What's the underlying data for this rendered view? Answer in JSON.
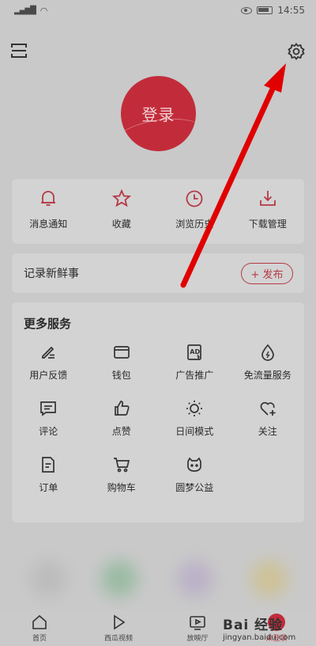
{
  "status_bar": {
    "carrier": "₀ᵢₗ",
    "time": "14:55"
  },
  "login": {
    "label": "登录"
  },
  "quick_actions": [
    {
      "label": "消息通知",
      "icon": "bell-icon"
    },
    {
      "label": "收藏",
      "icon": "star-icon"
    },
    {
      "label": "浏览历史",
      "icon": "clock-icon"
    },
    {
      "label": "下载管理",
      "icon": "download-icon"
    }
  ],
  "post_bar": {
    "label": "记录新鲜事",
    "button": "+ 发布"
  },
  "more_services": {
    "title": "更多服务",
    "items": [
      {
        "label": "用户反馈",
        "icon": "feedback-icon"
      },
      {
        "label": "钱包",
        "icon": "wallet-icon"
      },
      {
        "label": "广告推广",
        "icon": "ad-icon"
      },
      {
        "label": "免流量服务",
        "icon": "data-free-icon"
      },
      {
        "label": "评论",
        "icon": "comment-icon"
      },
      {
        "label": "点赞",
        "icon": "thumb-up-icon"
      },
      {
        "label": "日间模式",
        "icon": "sun-icon"
      },
      {
        "label": "关注",
        "icon": "heart-plus-icon"
      },
      {
        "label": "订单",
        "icon": "order-icon"
      },
      {
        "label": "购物车",
        "icon": "cart-icon"
      },
      {
        "label": "圆梦公益",
        "icon": "charity-icon"
      }
    ]
  },
  "tab_bar": [
    {
      "label": "首页",
      "icon": "home-icon"
    },
    {
      "label": "西瓜视频",
      "icon": "play-icon"
    },
    {
      "label": "放映厅",
      "icon": "tv-play-icon"
    },
    {
      "label": "未登录",
      "icon": "avatar-icon"
    }
  ],
  "watermark": {
    "brand": "Bai 经验",
    "url": "jingyan.baidu.com"
  },
  "colors": {
    "accent": "#c22c3a",
    "arrow": "#e00000"
  }
}
